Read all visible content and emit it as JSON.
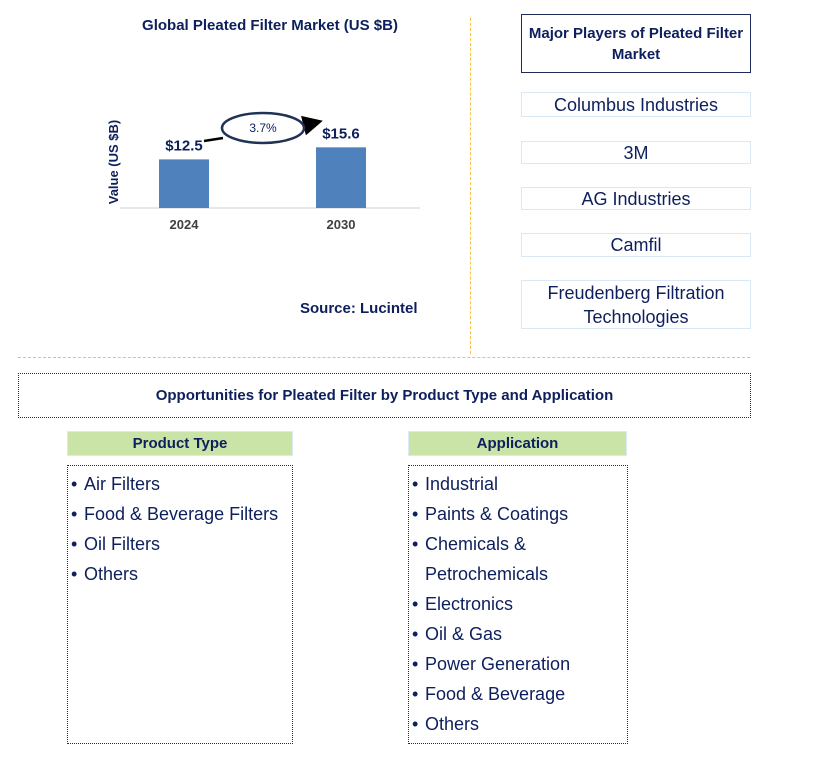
{
  "chart_data": {
    "type": "bar",
    "title": "Global Pleated Filter Market (US $B)",
    "xlabel": "",
    "ylabel": "Value (US $B)",
    "categories": [
      "2024",
      "2030"
    ],
    "values": [
      12.5,
      15.6
    ],
    "data_labels": [
      "$12.5",
      "$15.6"
    ],
    "ylim": [
      0,
      18
    ],
    "grid": false,
    "bar_color": "#4f81bd",
    "annotation": {
      "text": "3.7%",
      "meaning": "CAGR 2024-2030"
    }
  },
  "source": "Source: Lucintel",
  "players": {
    "title": "Major Players of Pleated Filter Market",
    "items": [
      "Columbus Industries",
      "3M",
      "AG Industries",
      "Camfil",
      "Freudenberg Filtration Technologies"
    ]
  },
  "opportunities": {
    "title": "Opportunities for Pleated Filter by Product Type and Application",
    "product_type": {
      "heading": "Product Type",
      "items": [
        "Air Filters",
        "Food & Beverage Filters",
        "Oil Filters",
        "Others"
      ]
    },
    "application": {
      "heading": "Application",
      "items": [
        "Industrial",
        "Paints & Coatings",
        "Chemicals &",
        "Petrochemicals",
        "Electronics",
        "Oil & Gas",
        "Power Generation",
        "Food & Beverage",
        "Others"
      ]
    }
  },
  "colors": {
    "text": "#0d1f5c",
    "bar": "#4f81bd",
    "divider": "#f5c242",
    "header_fill": "#c9e4a6"
  }
}
